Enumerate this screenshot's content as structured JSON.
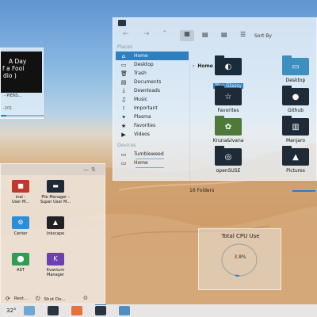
{
  "music": {
    "album_lines": [
      "A Day",
      "f a Fool",
      "dio )"
    ],
    "artist": "- PIENS...",
    "year": "-201",
    "progress": 0.12
  },
  "file_manager": {
    "toolbar": {
      "sort_label": "Sort By"
    },
    "places_header": "Places",
    "devices_header": "Devices",
    "places": [
      {
        "label": "Home",
        "icon": "home-icon",
        "selected": true
      },
      {
        "label": "Desktop",
        "icon": "desktop-icon"
      },
      {
        "label": "Trash",
        "icon": "trash-icon"
      },
      {
        "label": "Documents",
        "icon": "documents-icon"
      },
      {
        "label": "Downloads",
        "icon": "downloads-icon"
      },
      {
        "label": "Music",
        "icon": "music-icon"
      },
      {
        "label": "Important",
        "icon": "important-icon"
      },
      {
        "label": "Plasma",
        "icon": "plasma-icon"
      },
      {
        "label": "Favorites",
        "icon": "star-icon"
      },
      {
        "label": "Videos",
        "icon": "videos-icon"
      }
    ],
    "devices": [
      {
        "label": "Tumbleweed",
        "icon": "drive-icon"
      },
      {
        "label": "Home",
        "icon": "drive-icon"
      }
    ],
    "breadcrumb": "Home",
    "folders": [
      {
        "label": "Blur-Glassy",
        "icon": "blur-glassy-folder-icon",
        "selected": true,
        "color": "#1a2b3c"
      },
      {
        "label": "Desktop",
        "icon": "desktop-folder-icon",
        "color": "#3d8fc0"
      },
      {
        "label": "Favorites",
        "icon": "star-folder-icon",
        "color": "#1f2a38"
      },
      {
        "label": "Github",
        "icon": "github-folder-icon",
        "color": "#1f2a38"
      },
      {
        "label": "Kruna&Ivana",
        "icon": "photo-folder-icon",
        "color": "#4d7a39"
      },
      {
        "label": "Manjaro",
        "icon": "manjaro-folder-icon",
        "color": "#1f2a38"
      },
      {
        "label": "openSUSE",
        "icon": "opensuse-folder-icon",
        "color": "#1f2a38"
      },
      {
        "label": "Pictures",
        "icon": "pictures-folder-icon",
        "color": "#1f2a38"
      }
    ],
    "status": "16 Folders",
    "zoom_level": 0.9
  },
  "cpu": {
    "title": "Total CPU Use",
    "value": "3.8%",
    "fraction": 0.038
  },
  "launcher": {
    "apps": [
      {
        "label": [
          "inal -",
          "User M..."
        ],
        "icon": "terminal-icon",
        "color": "#c0392b"
      },
      {
        "label": [
          "File Manager -",
          "Super User M..."
        ],
        "icon": "file-manager-icon",
        "color": "#1f2a38"
      },
      {
        "label": [
          "Center"
        ],
        "icon": "control-center-icon",
        "color": "#2c8fd6"
      },
      {
        "label": [
          "Inkscape"
        ],
        "icon": "inkscape-icon",
        "color": "#222"
      },
      {
        "label": [
          "AST"
        ],
        "icon": "ast-icon",
        "color": "#2e9e53"
      },
      {
        "label": [
          "Kvantum",
          "Manager"
        ],
        "icon": "kvantum-icon",
        "color": "#6c3fb5"
      }
    ],
    "footer": [
      {
        "label": "Rest...",
        "icon": "restart-icon"
      },
      {
        "label": "Shut Do...",
        "icon": "shutdown-icon"
      }
    ]
  },
  "taskbar": {
    "temperature": "32°",
    "tasks": [
      {
        "icon": "system-settings-task-icon",
        "color": "#6fa7d6"
      },
      {
        "icon": "terminal-task-icon",
        "color": "#2b3440"
      },
      {
        "icon": "firefox-task-icon",
        "color": "#e8733a"
      },
      {
        "icon": "file-manager-task-icon",
        "color": "#2b3440",
        "active": true
      },
      {
        "icon": "monitor-task-icon",
        "color": "#4f8fbf"
      }
    ]
  }
}
